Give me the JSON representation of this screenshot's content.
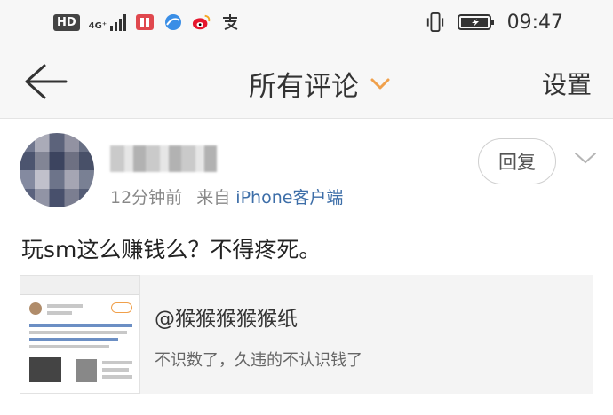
{
  "status_bar": {
    "hd_badge": "HD",
    "network": "4G⁺",
    "time": "09:47",
    "icons": [
      "hd-icon",
      "signal-icon",
      "book-app-icon",
      "browser-app-icon",
      "weibo-app-icon",
      "alipay-app-icon",
      "vibrate-icon",
      "battery-icon"
    ]
  },
  "header": {
    "title": "所有评论",
    "settings_label": "设置",
    "accent_color": "#f0a04b"
  },
  "comment": {
    "timestamp": "12分钟前",
    "source_prefix": "来自",
    "source": "iPhone客户端",
    "reply_label": "回复",
    "text": "玩sm这么赚钱么？不得疼死。",
    "source_color": "#3d6ea8"
  },
  "quoted": {
    "title": "@猴猴猴猴猴纸",
    "subtitle": "不识数了，久违的不认识钱了"
  }
}
